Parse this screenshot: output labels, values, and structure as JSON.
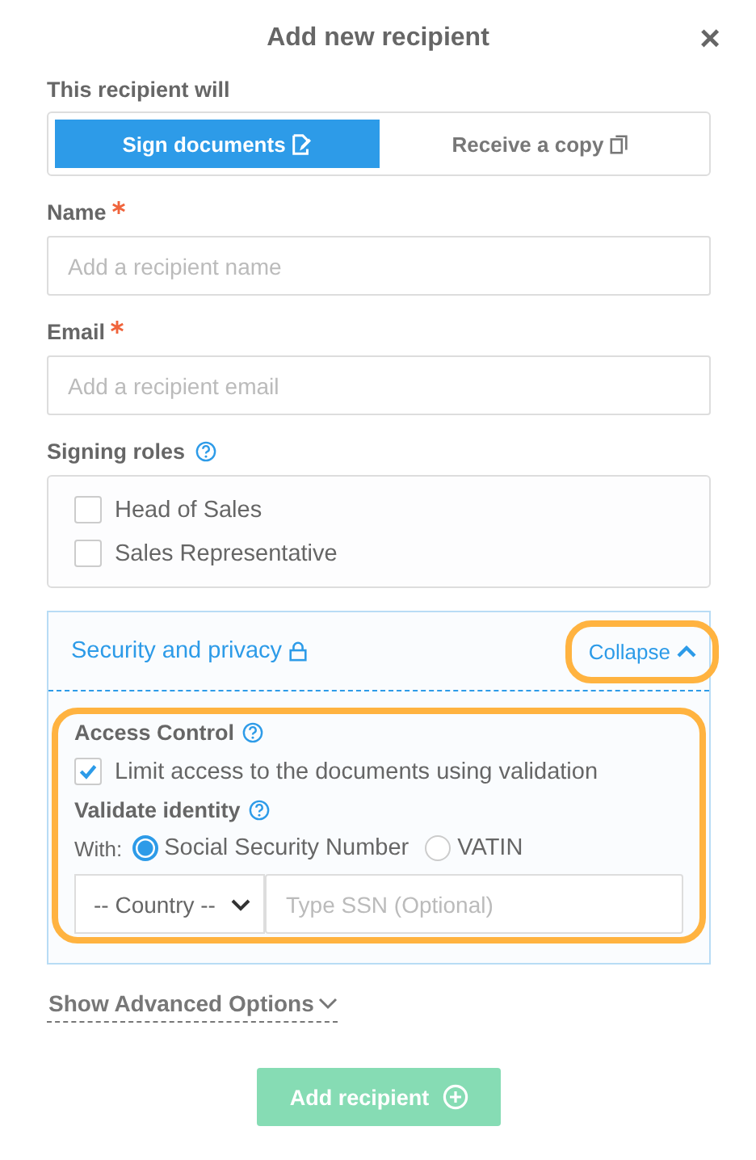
{
  "dialog": {
    "title": "Add new recipient",
    "close": "×"
  },
  "role_toggle": {
    "label": "This recipient will",
    "options": [
      {
        "label": "Sign documents",
        "selected": true,
        "kind": "sign"
      },
      {
        "label": "Receive a copy",
        "selected": false,
        "kind": "copy"
      }
    ]
  },
  "fields": [
    {
      "label": "Name",
      "required": true,
      "placeholder": "Add a recipient name"
    },
    {
      "label": "Email",
      "required": true,
      "placeholder": "Add a recipient email"
    }
  ],
  "signing_roles": {
    "label": "Signing roles",
    "options": [
      {
        "label": "Head of Sales",
        "checked": false
      },
      {
        "label": "Sales Representative",
        "checked": false
      }
    ]
  },
  "security": {
    "title": "Security and privacy",
    "toggle": "Collapse",
    "expanded": true,
    "toggle_highlighted": true,
    "body_highlighted": true,
    "access_control": {
      "label": "Access Control",
      "option": {
        "label": "Limit access to the documents using validation",
        "checked": true
      }
    },
    "validate_identity": {
      "label": "Validate identity",
      "with_label": "With:",
      "methods": [
        {
          "label": "Social Security Number",
          "selected": true
        },
        {
          "label": "VATIN",
          "selected": false
        }
      ],
      "country": "-- Country --",
      "id_placeholder": "Type SSN (Optional)"
    }
  },
  "advanced_toggle": "Show Advanced Options",
  "submit": {
    "label": "Add recipient",
    "disabled": true
  }
}
